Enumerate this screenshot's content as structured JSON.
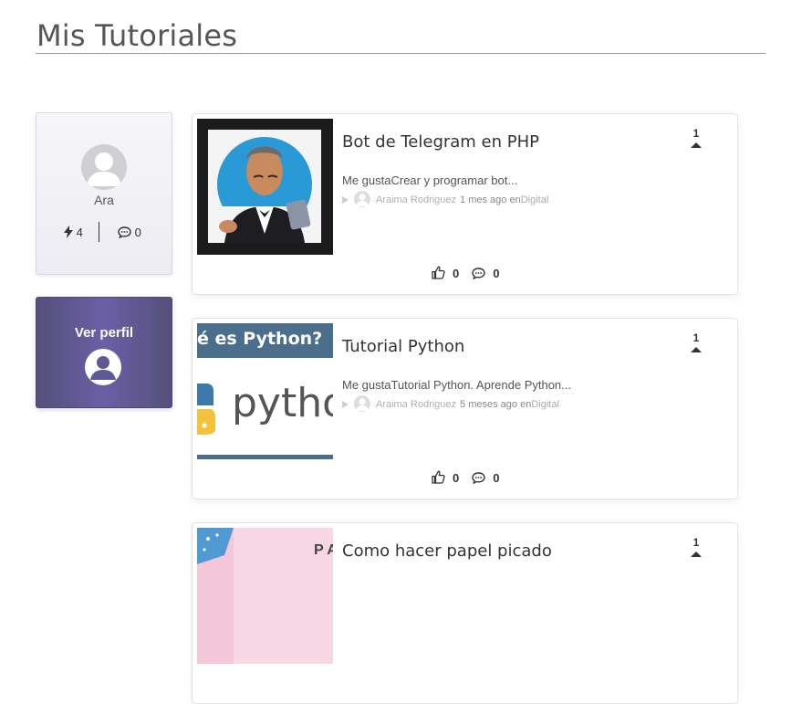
{
  "page": {
    "title": "Mis Tutoriales"
  },
  "profile": {
    "name": "Ara",
    "bolt_count": "4",
    "comment_count": "0",
    "button_label": "Ver perfil"
  },
  "posts": [
    {
      "title": "Bot de Telegram en PHP",
      "excerpt": "Me gustaCrear y programar bot...",
      "author": "Araima Rodriguez",
      "time": "1 mes ago en",
      "category": "Digital",
      "votes": "1",
      "likes": "0",
      "comments": "0"
    },
    {
      "title": "Tutorial Python",
      "excerpt": "Me gustaTutorial Python. Aprende Python...",
      "author": "Araima Rodriguez",
      "time": "5 meses ago en",
      "category": "Digital",
      "votes": "1",
      "likes": "0",
      "comments": "0",
      "thumb_text_top": "é es Python?",
      "thumb_text_main": "pytho"
    },
    {
      "title": "Como hacer papel picado",
      "votes": "1",
      "thumb_text": "P A"
    }
  ],
  "icons": {
    "bolt": "bolt-icon",
    "comment": "comment-icon",
    "thumbs_up": "thumbs-up-icon",
    "user": "user-circle-icon",
    "vote_up": "caret-up-icon"
  }
}
